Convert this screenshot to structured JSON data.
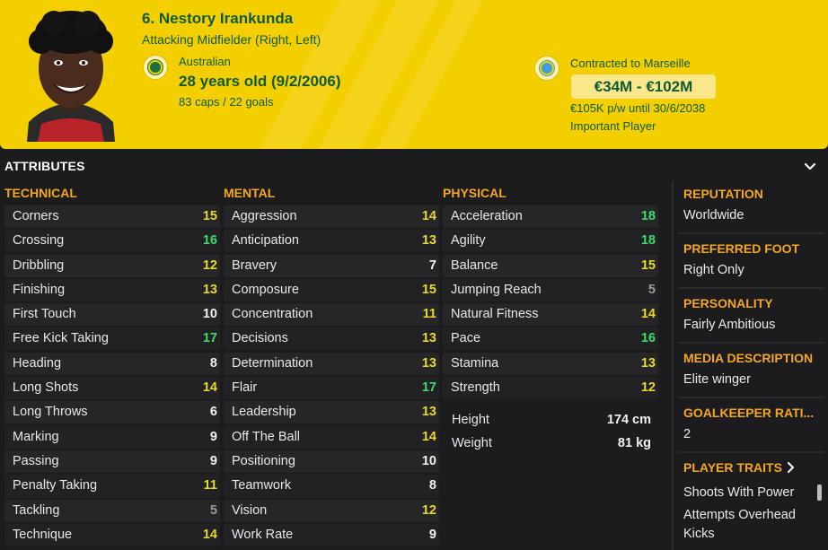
{
  "player": {
    "name": "6. Nestory Irankunda",
    "position": "Attacking Midfielder (Right, Left)",
    "nationality": "Australian",
    "age": "28 years old (9/2/2006)",
    "caps": "83 caps / 22 goals",
    "contract": "Contracted to Marseille",
    "value": "€34M - €102M",
    "wage": "€105K p/w until 30/6/2038",
    "status": "Important Player"
  },
  "attributes": {
    "title": "ATTRIBUTES",
    "technical": {
      "header": "TECHNICAL",
      "items": [
        {
          "label": "Corners",
          "value": "15",
          "color": "yellow"
        },
        {
          "label": "Crossing",
          "value": "16",
          "color": "green"
        },
        {
          "label": "Dribbling",
          "value": "12",
          "color": "yellow"
        },
        {
          "label": "Finishing",
          "value": "13",
          "color": "yellow"
        },
        {
          "label": "First Touch",
          "value": "10",
          "color": "white"
        },
        {
          "label": "Free Kick Taking",
          "value": "17",
          "color": "green"
        },
        {
          "label": "Heading",
          "value": "8",
          "color": "white"
        },
        {
          "label": "Long Shots",
          "value": "14",
          "color": "yellow"
        },
        {
          "label": "Long Throws",
          "value": "6",
          "color": "white"
        },
        {
          "label": "Marking",
          "value": "9",
          "color": "white"
        },
        {
          "label": "Passing",
          "value": "9",
          "color": "white"
        },
        {
          "label": "Penalty Taking",
          "value": "11",
          "color": "yellow"
        },
        {
          "label": "Tackling",
          "value": "5",
          "color": "grey"
        },
        {
          "label": "Technique",
          "value": "14",
          "color": "yellow"
        }
      ]
    },
    "mental": {
      "header": "MENTAL",
      "items": [
        {
          "label": "Aggression",
          "value": "14",
          "color": "yellow"
        },
        {
          "label": "Anticipation",
          "value": "13",
          "color": "yellow"
        },
        {
          "label": "Bravery",
          "value": "7",
          "color": "white"
        },
        {
          "label": "Composure",
          "value": "15",
          "color": "yellow"
        },
        {
          "label": "Concentration",
          "value": "11",
          "color": "yellow"
        },
        {
          "label": "Decisions",
          "value": "13",
          "color": "yellow"
        },
        {
          "label": "Determination",
          "value": "13",
          "color": "yellow"
        },
        {
          "label": "Flair",
          "value": "17",
          "color": "green"
        },
        {
          "label": "Leadership",
          "value": "13",
          "color": "yellow"
        },
        {
          "label": "Off The Ball",
          "value": "14",
          "color": "yellow"
        },
        {
          "label": "Positioning",
          "value": "10",
          "color": "white"
        },
        {
          "label": "Teamwork",
          "value": "8",
          "color": "white"
        },
        {
          "label": "Vision",
          "value": "12",
          "color": "yellow"
        },
        {
          "label": "Work Rate",
          "value": "9",
          "color": "white"
        }
      ]
    },
    "physical": {
      "header": "PHYSICAL",
      "items": [
        {
          "label": "Acceleration",
          "value": "18",
          "color": "green"
        },
        {
          "label": "Agility",
          "value": "18",
          "color": "green"
        },
        {
          "label": "Balance",
          "value": "15",
          "color": "yellow"
        },
        {
          "label": "Jumping Reach",
          "value": "5",
          "color": "grey"
        },
        {
          "label": "Natural Fitness",
          "value": "14",
          "color": "yellow"
        },
        {
          "label": "Pace",
          "value": "16",
          "color": "green"
        },
        {
          "label": "Stamina",
          "value": "13",
          "color": "yellow"
        },
        {
          "label": "Strength",
          "value": "12",
          "color": "yellow"
        }
      ],
      "height_label": "Height",
      "height_value": "174 cm",
      "weight_label": "Weight",
      "weight_value": "81 kg"
    }
  },
  "side_panel": {
    "reputation_label": "REPUTATION",
    "reputation_value": "Worldwide",
    "foot_label": "PREFERRED FOOT",
    "foot_value": "Right Only",
    "personality_label": "PERSONALITY",
    "personality_value": "Fairly Ambitious",
    "media_label": "MEDIA DESCRIPTION",
    "media_value": "Elite winger",
    "gk_label": "GOALKEEPER RATI...",
    "gk_value": "2",
    "traits_label": "PLAYER TRAITS",
    "traits": [
      "Shoots With Power",
      "Attempts Overhead",
      "Kicks"
    ]
  },
  "colors": {
    "header_bg": "#f4cf00",
    "header_text": "#0f5a34",
    "accent_orange": "#f5a623",
    "green": "#3ddc6a",
    "yellow": "#e8d92b",
    "white": "#f2f2f2",
    "grey": "#9a9a9a"
  },
  "icons": {
    "nation_badge": "australia-federation-crest-icon",
    "club_badge": "marseille-crest-icon",
    "collapse": "chevron-down-icon",
    "traits_arrow": "chevron-right-icon"
  }
}
